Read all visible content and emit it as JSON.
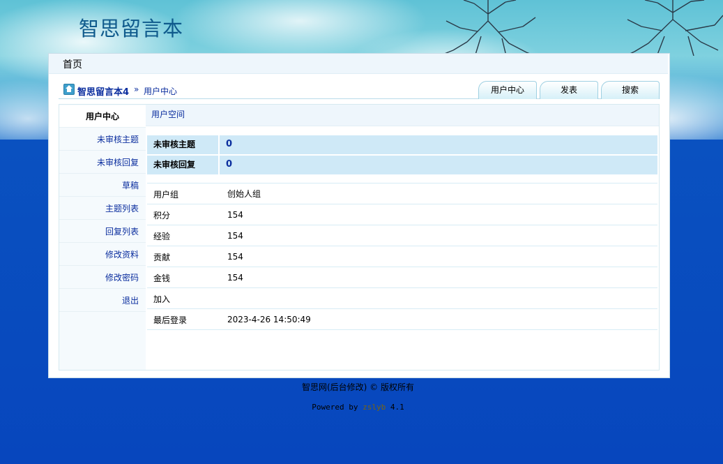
{
  "site_title": "智思留言本",
  "topnav": {
    "home": "首页"
  },
  "breadcrumb": {
    "site": "智思留言本4",
    "separator": "»",
    "current": "用户中心"
  },
  "tabs": [
    "用户中心",
    "发表",
    "搜索"
  ],
  "sidebar": {
    "items": [
      {
        "label": "用户中心",
        "active": true
      },
      {
        "label": "未审核主题"
      },
      {
        "label": "未审核回复"
      },
      {
        "label": "草稿"
      },
      {
        "label": "主题列表"
      },
      {
        "label": "回复列表"
      },
      {
        "label": "修改资料"
      },
      {
        "label": "修改密码"
      },
      {
        "label": "退出"
      }
    ]
  },
  "content": {
    "header": "用户空间",
    "highlight": [
      {
        "label": "未审核主题",
        "value": "0"
      },
      {
        "label": "未审核回复",
        "value": "0"
      }
    ],
    "info": [
      {
        "label": "用户组",
        "value": "创始人组"
      },
      {
        "label": "积分",
        "value": "154"
      },
      {
        "label": "经验",
        "value": "154"
      },
      {
        "label": "贡献",
        "value": "154"
      },
      {
        "label": "金钱",
        "value": "154"
      },
      {
        "label": "加入",
        "value": ""
      },
      {
        "label": "最后登录",
        "value": "2023-4-26 14:50:49"
      }
    ]
  },
  "footer": {
    "copyright": "智思网(后台修改) © 版权所有",
    "powered_prefix": "Powered by",
    "powered_brand": "zslyb",
    "powered_version": "4.1"
  },
  "colors": {
    "link": "#0b2e9e",
    "highlight_bg": "#cfe9f7",
    "page_bg": "#0746bd"
  },
  "icons": [
    "home-icon"
  ]
}
